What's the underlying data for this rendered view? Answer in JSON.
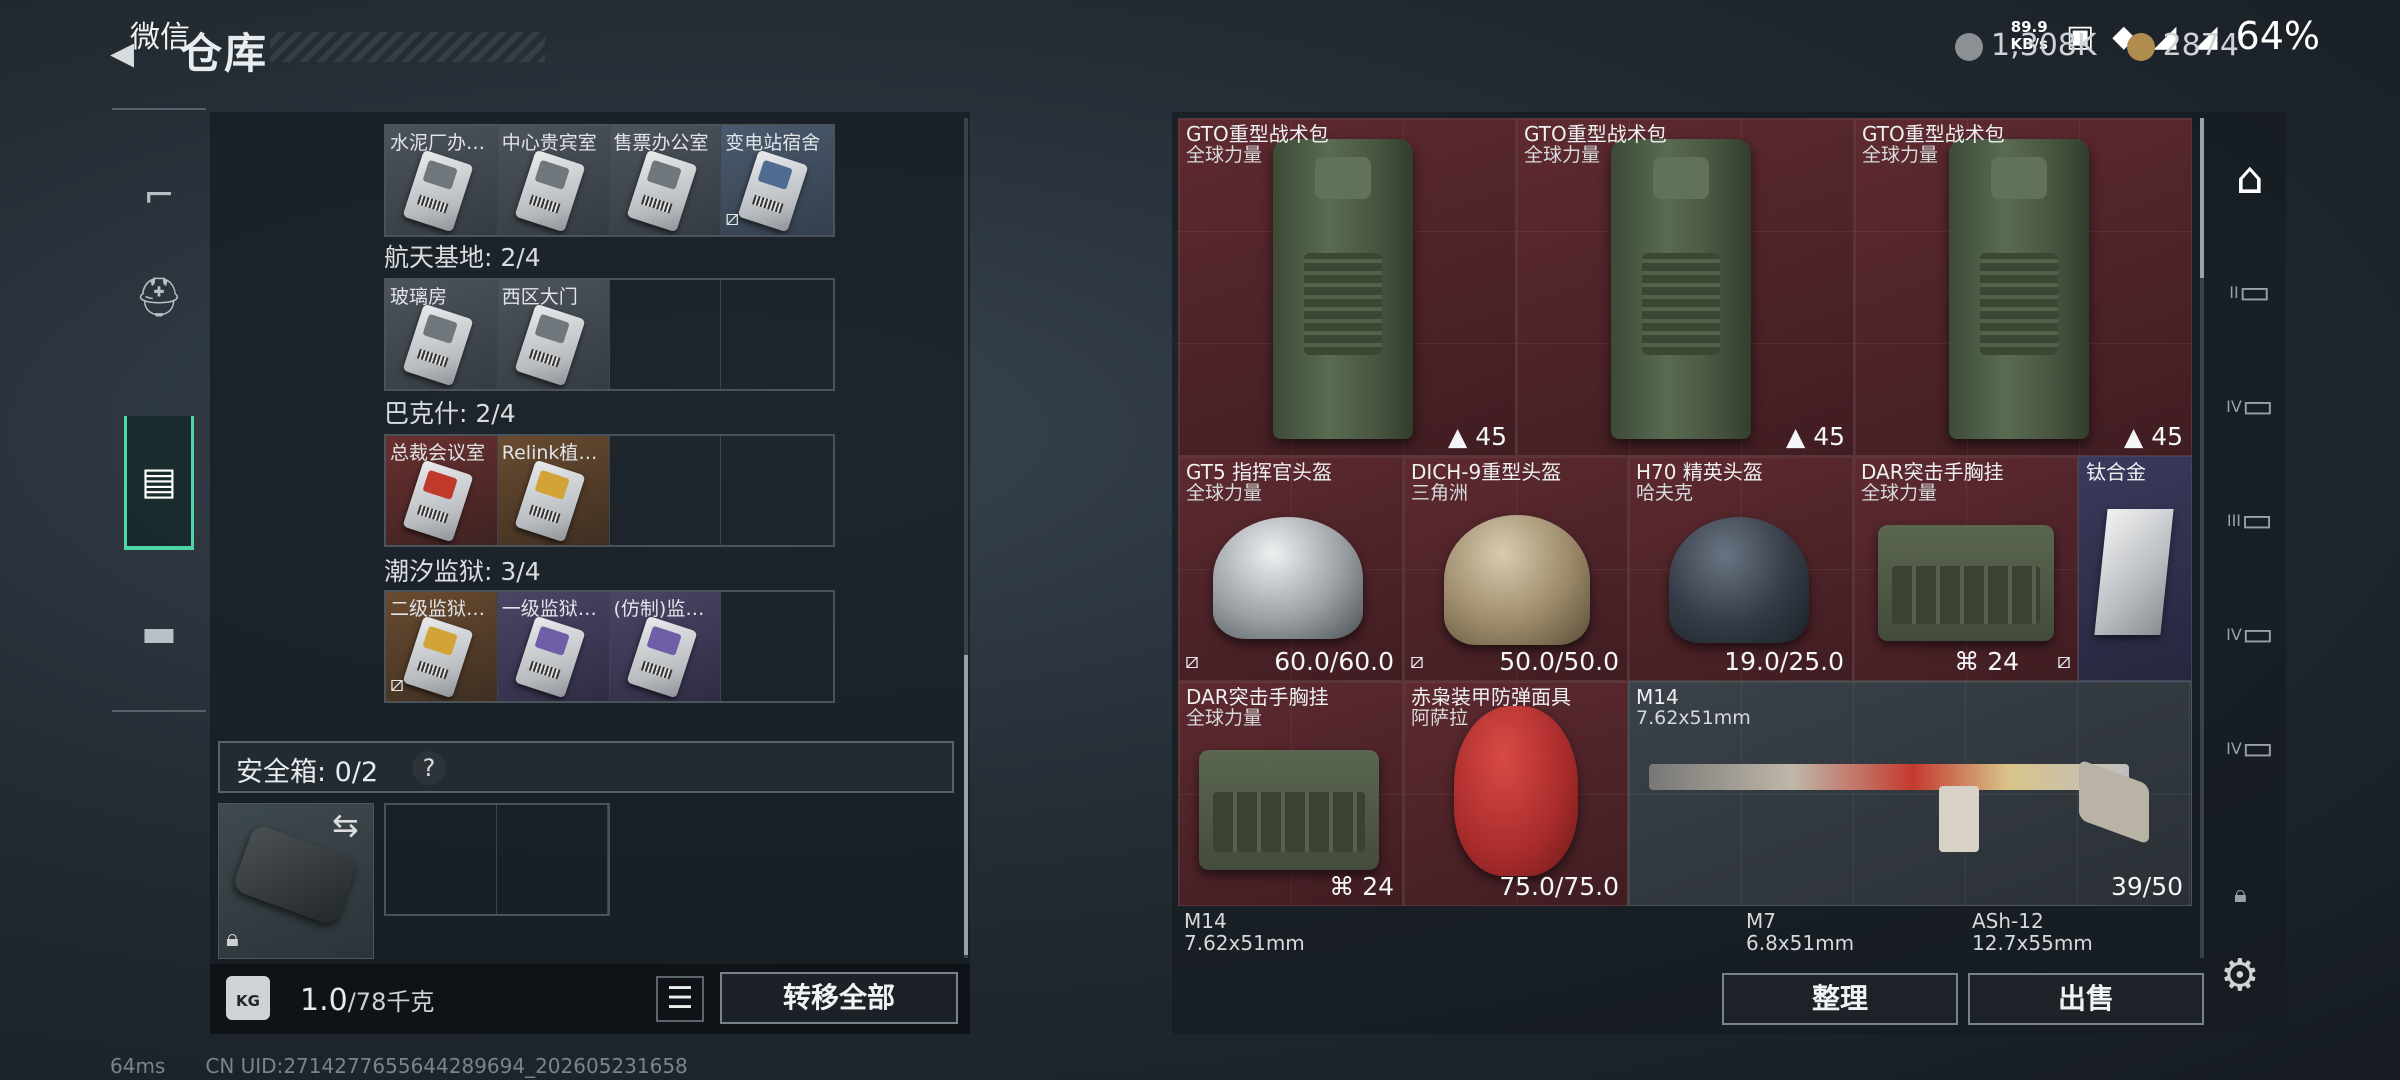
{
  "status_bar": {
    "app": "微信",
    "speed_value": "89.9",
    "speed_unit": "KB/s",
    "battery": "64%"
  },
  "header": {
    "title": "仓库",
    "currency_1": "1,308K",
    "currency_2": "2874"
  },
  "left_nav": {
    "items": [
      "weapon-icon",
      "helmet-armor-icon",
      "backpack-icon",
      "toolbox-icon"
    ],
    "active_index": 2
  },
  "key_groups": [
    {
      "label": "",
      "keys": [
        {
          "name": "水泥厂办…",
          "color": "grey",
          "no_link": false
        },
        {
          "name": "中心贵宾室",
          "color": "grey",
          "no_link": false
        },
        {
          "name": "售票办公室",
          "color": "grey",
          "no_link": false
        },
        {
          "name": "变电站宿舍",
          "color": "blue",
          "no_link": true
        }
      ]
    },
    {
      "label": "航天基地: 2/4",
      "keys": [
        {
          "name": "玻璃房",
          "color": "grey",
          "no_link": false
        },
        {
          "name": "西区大门",
          "color": "grey",
          "no_link": false
        }
      ]
    },
    {
      "label": "巴克什: 2/4",
      "keys": [
        {
          "name": "总裁会议室",
          "color": "red",
          "no_link": false
        },
        {
          "name": "Relink植…",
          "color": "gold",
          "no_link": false
        }
      ]
    },
    {
      "label": "潮汐监狱: 3/4",
      "keys": [
        {
          "name": "二级监狱…",
          "color": "gold",
          "no_link": true
        },
        {
          "name": "一级监狱…",
          "color": "purple",
          "no_link": false
        },
        {
          "name": "(仿制)监…",
          "color": "purple",
          "no_link": false
        }
      ]
    }
  ],
  "safebox": {
    "label": "安全箱: 0/2",
    "help": "?"
  },
  "weight": {
    "icon_label": "KG",
    "current": "1.0",
    "max": "/78千克"
  },
  "left_actions": {
    "transfer_all": "转移全部"
  },
  "items": [
    {
      "name": "GTO重型战术包",
      "sub": "全球力量",
      "value": "45",
      "color": "red"
    },
    {
      "name": "GTO重型战术包",
      "sub": "全球力量",
      "value": "45",
      "color": "red"
    },
    {
      "name": "GTO重型战术包",
      "sub": "全球力量",
      "value": "45",
      "color": "red"
    },
    {
      "name": "GT5 指挥官头盔",
      "sub": "全球力量",
      "value": "60.0/60.0",
      "color": "red"
    },
    {
      "name": "DICH-9重型头盔",
      "sub": "三角洲",
      "value": "50.0/50.0",
      "color": "red"
    },
    {
      "name": "H70 精英头盔",
      "sub": "哈夫克",
      "value": "19.0/25.0",
      "color": "red"
    },
    {
      "name": "DAR突击手胸挂",
      "sub": "全球力量",
      "value": "24",
      "color": "red"
    },
    {
      "name": "钛合金",
      "sub": "",
      "value": "",
      "color": "purple"
    },
    {
      "name": "DAR突击手胸挂",
      "sub": "全球力量",
      "value": "24",
      "color": "red"
    },
    {
      "name": "赤枭装甲防弹面具",
      "sub": "阿萨拉",
      "value": "75.0/75.0",
      "color": "red"
    },
    {
      "name": "M14",
      "sub": "7.62x51mm",
      "value": "39/50",
      "color": "grey"
    }
  ],
  "bottom_row": [
    {
      "name": "M14",
      "sub": "7.62x51mm"
    },
    {
      "name": "M7",
      "sub": "6.8x51mm"
    },
    {
      "name": "ASh-12",
      "sub": "12.7x55mm"
    }
  ],
  "right_actions": {
    "sort": "整理",
    "sell": "出售"
  },
  "filter_rail": {
    "tiers": [
      "II",
      "IV",
      "III",
      "IV",
      "IV"
    ]
  },
  "debug": {
    "ping": "64ms",
    "uid": "CN UID:2714277655644289694_202605231658"
  }
}
